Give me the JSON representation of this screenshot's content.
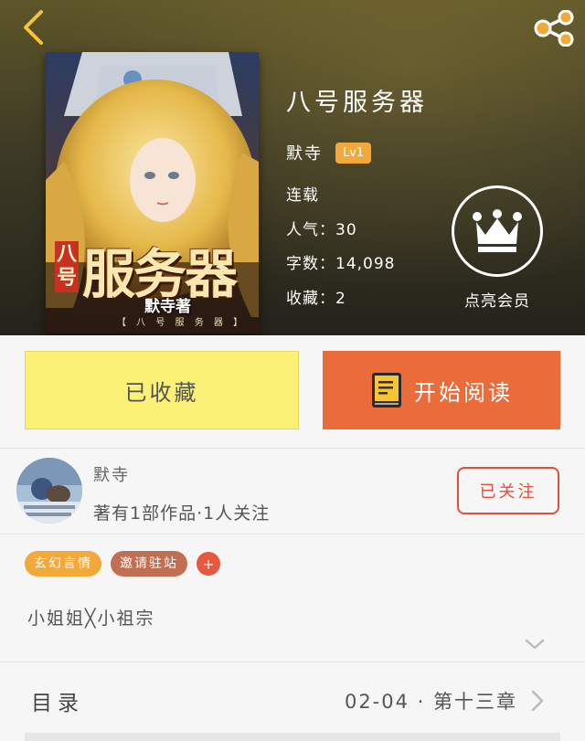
{
  "nav": {
    "back_icon": "chevron-left-icon",
    "share_icon": "share-icon"
  },
  "book": {
    "cover_title_top": "八号",
    "cover_title_main": "服务器",
    "cover_author": "默寺著",
    "cover_subtitle": "【 八 号 服 务 器 】",
    "title": "八号服务器",
    "author": "默寺",
    "level": "Lv1",
    "status": "连载",
    "popularity": "人气：30",
    "word_count": "字数：14,098",
    "favorites": "收藏：2"
  },
  "vip": {
    "icon": "crown-icon",
    "label": "点亮会员"
  },
  "actions": {
    "collect_label": "已收藏",
    "read_label": "开始阅读",
    "read_icon": "book-icon"
  },
  "author_card": {
    "name": "默寺",
    "stats": "著有1部作品·1人关注",
    "follow_label": "已关注"
  },
  "tags": [
    {
      "label": "玄幻言情"
    },
    {
      "label": "邀请驻站"
    }
  ],
  "tag_add_label": "+",
  "description": "小姐姐╳小祖宗",
  "toc": {
    "label": "目录",
    "latest": "02-04 · 第十三章"
  },
  "colors": {
    "accent_orange": "#ea6c3b",
    "collect_yellow": "#fbf176",
    "tag_orange": "#f3a93a",
    "tag_brown": "#c26e52",
    "follow_red": "#e0503c"
  }
}
